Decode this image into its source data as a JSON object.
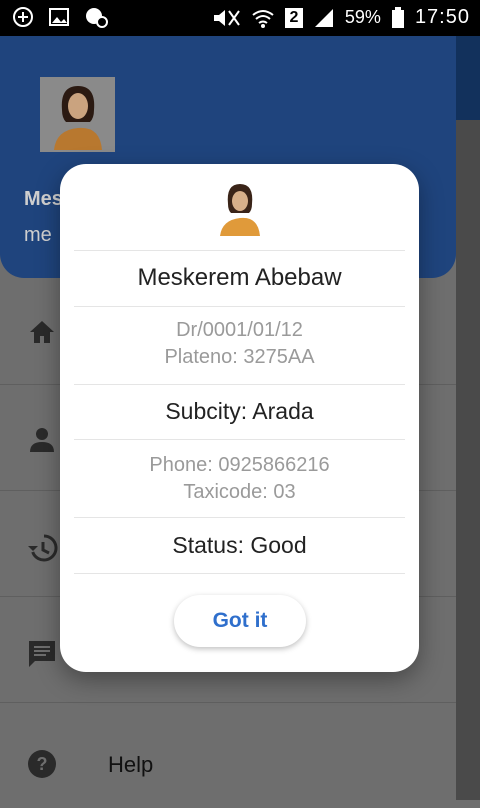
{
  "status_bar": {
    "battery": "59%",
    "sim_slot": "2",
    "time": "17:50",
    "icons": [
      "add-notification-icon",
      "image-icon",
      "badge-icon",
      "mute-icon",
      "wifi-icon",
      "signal-icon",
      "battery-icon"
    ]
  },
  "drawer": {
    "header": {
      "name_partial": "Mes",
      "sub_partial": "me",
      "color": "#1f447d"
    },
    "menu": [
      {
        "icon": "home-icon",
        "label": ""
      },
      {
        "icon": "person-icon",
        "label": ""
      },
      {
        "icon": "history-icon",
        "label": ""
      },
      {
        "icon": "message-icon",
        "label": ""
      },
      {
        "icon": "help-icon",
        "label": "Help"
      }
    ]
  },
  "dialog": {
    "name": "Meskerem Abebaw",
    "line1": "Dr/0001/01/12",
    "line2": "Plateno: 3275AA",
    "subcity": "Subcity: Arada",
    "phone": "Phone: 0925866216",
    "taxicode": "Taxicode: 03",
    "status": "Status: Good",
    "button": "Got it",
    "accent": "#2f6fcc"
  }
}
